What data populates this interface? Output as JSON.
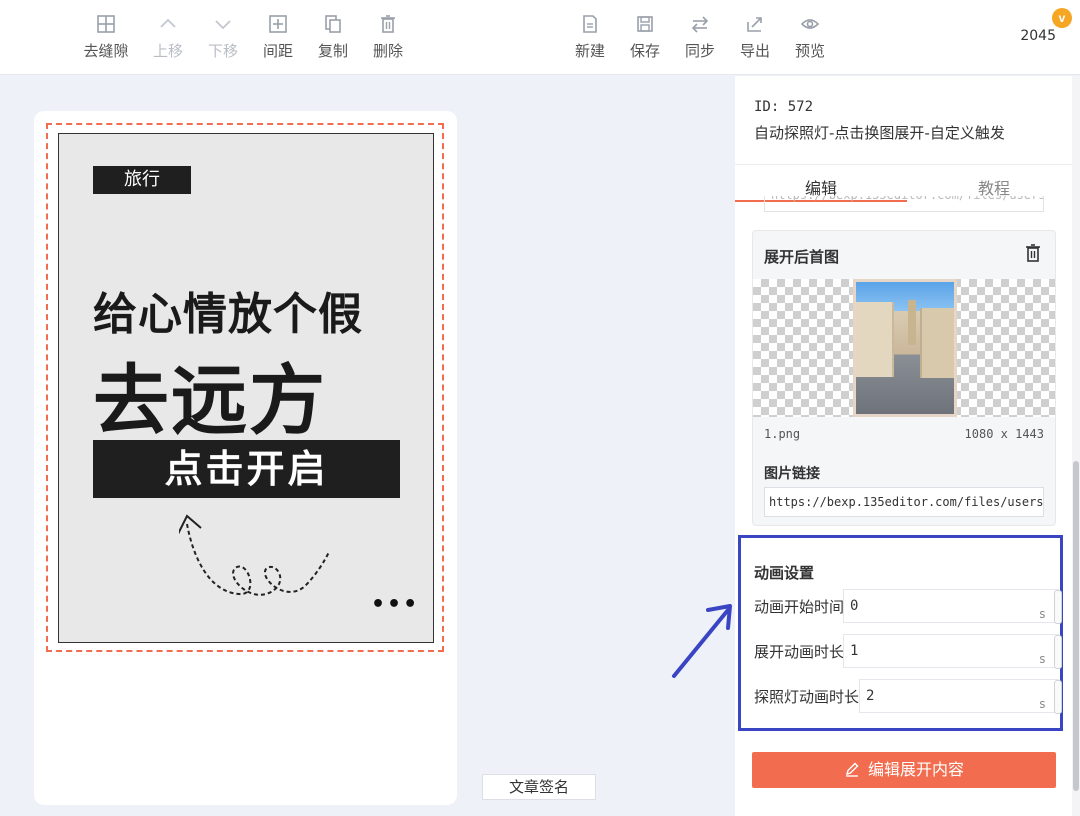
{
  "toolbar": {
    "left_tools": [
      {
        "label": "去缝隙",
        "icon": "grid-plus-icon",
        "disabled": false
      },
      {
        "label": "上移",
        "icon": "chevron-up-icon",
        "disabled": true
      },
      {
        "label": "下移",
        "icon": "chevron-down-icon",
        "disabled": true
      },
      {
        "label": "间距",
        "icon": "spacing-icon",
        "disabled": false
      },
      {
        "label": "复制",
        "icon": "copy-icon",
        "disabled": false
      },
      {
        "label": "删除",
        "icon": "trash-icon",
        "disabled": false
      }
    ],
    "right_tools": [
      {
        "label": "新建",
        "icon": "new-file-icon"
      },
      {
        "label": "保存",
        "icon": "save-icon"
      },
      {
        "label": "同步",
        "icon": "sync-icon"
      },
      {
        "label": "导出",
        "icon": "export-icon"
      },
      {
        "label": "预览",
        "icon": "eye-icon"
      }
    ],
    "user_count": "2045",
    "vip_badge": "v"
  },
  "poster": {
    "tag": "旅行",
    "headline1": "给心情放个假",
    "headline2": "去远方",
    "cta": "点击开启",
    "more": "•••"
  },
  "signature": "文章签名",
  "panel": {
    "id_text": "ID: 572",
    "title": "自动探照灯-点击换图展开-自定义触发",
    "tabs": [
      "编辑",
      "教程"
    ],
    "image_card": {
      "title": "展开后首图",
      "file_name": "1.png",
      "dimensions": "1080 x 1443",
      "link_label": "图片链接",
      "link_value": "https://bexp.135editor.com/files/users/C"
    },
    "animation": {
      "title": "动画设置",
      "rows": [
        {
          "label": "动画开始时间",
          "value": "0",
          "unit": "s"
        },
        {
          "label": "展开动画时长",
          "value": "1",
          "unit": "s"
        },
        {
          "label": "探照灯动画时长",
          "value": "2",
          "unit": "s"
        }
      ]
    },
    "edit_button": "编辑展开内容"
  },
  "colors": {
    "accent": "#f26d4f",
    "highlight_box": "#3a45c4",
    "poster_dark": "#1f1f1f"
  }
}
